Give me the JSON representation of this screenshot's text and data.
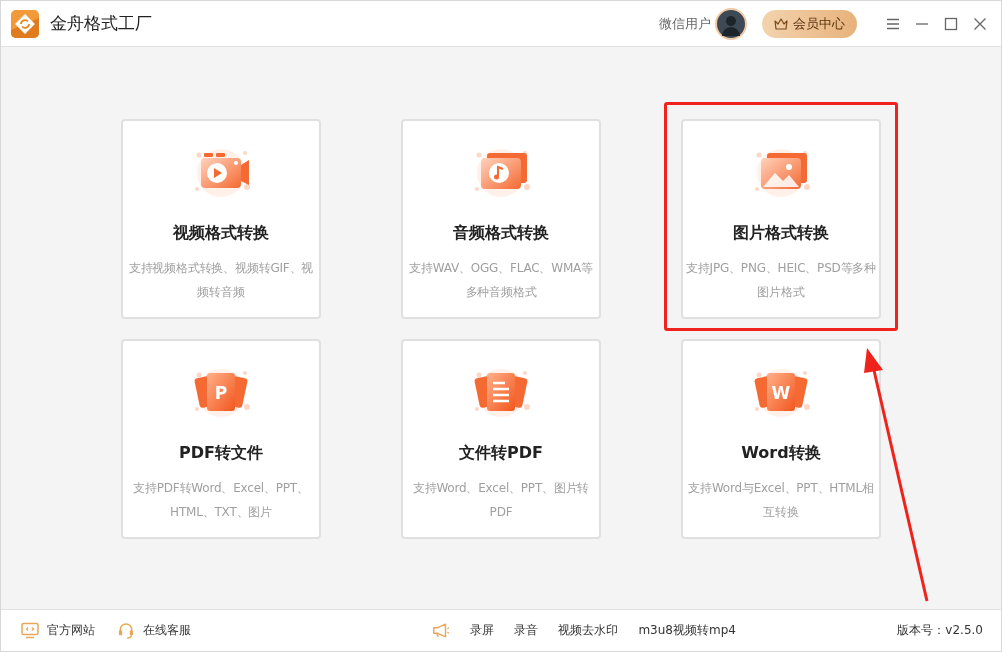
{
  "window": {
    "title": "金舟格式工厂"
  },
  "user": {
    "name": "微信用户"
  },
  "vip_button": {
    "label": "会员中心"
  },
  "cards": [
    {
      "kind": "video",
      "title": "视频格式转换",
      "description": "支持视频格式转换、视频转GIF、视频转音频",
      "highlighted": false
    },
    {
      "kind": "audio",
      "title": "音频格式转换",
      "description": "支持WAV、OGG、FLAC、WMA等多种音频格式",
      "highlighted": false
    },
    {
      "kind": "image",
      "title": "图片格式转换",
      "description": "支持JPG、PNG、HEIC、PSD等多种图片格式",
      "highlighted": true
    },
    {
      "kind": "letter",
      "icon_letter": "P",
      "title": "PDF转文件",
      "description": "支持PDF转Word、Excel、PPT、HTML、TXT、图片",
      "highlighted": false
    },
    {
      "kind": "document",
      "title": "文件转PDF",
      "description": "支持Word、Excel、PPT、图片转PDF",
      "highlighted": false
    },
    {
      "kind": "letter",
      "icon_letter": "W",
      "title": "Word转换",
      "description": "支持Word与Excel、PPT、HTML相互转换",
      "highlighted": false
    }
  ],
  "footer": {
    "left_links": [
      {
        "kind": "website",
        "label": "官方网站"
      },
      {
        "kind": "support",
        "label": "在线客服"
      }
    ],
    "center_links": [
      "录屏",
      "录音",
      "视频去水印",
      "m3u8视频转mp4"
    ],
    "version": "版本号：v2.5.0"
  }
}
